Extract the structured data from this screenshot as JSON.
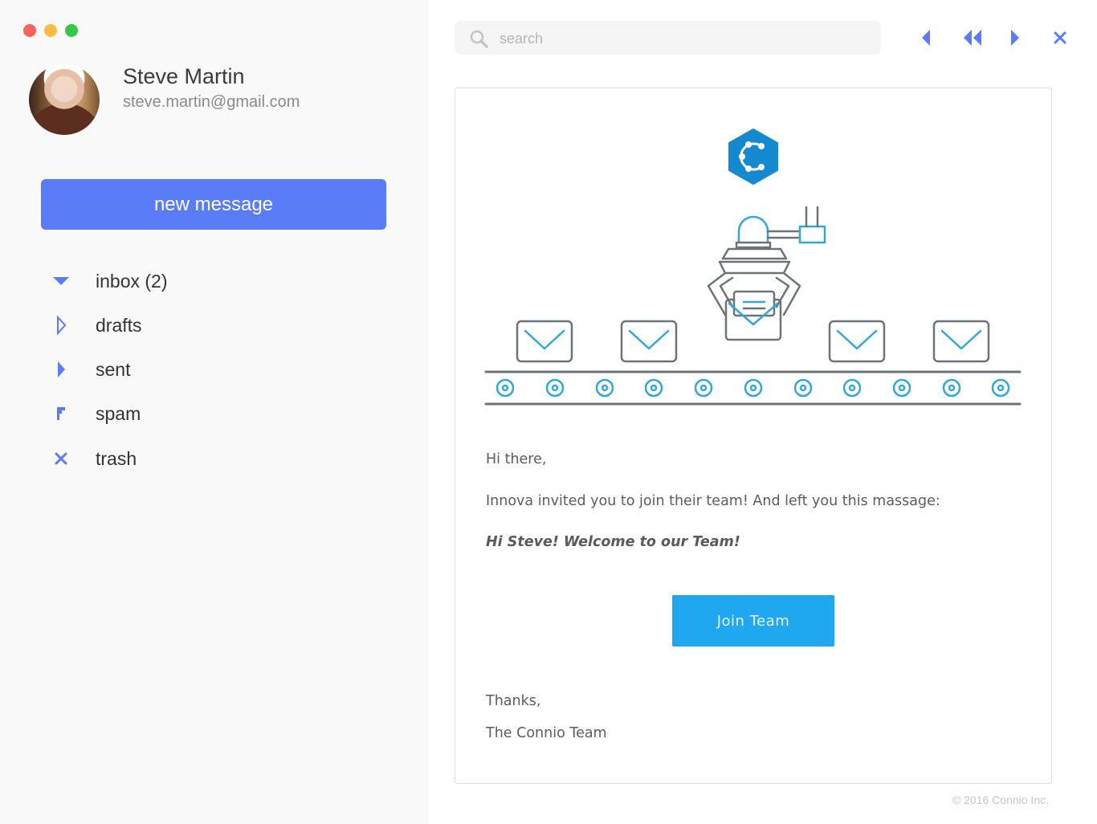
{
  "user": {
    "name": "Steve Martin",
    "email": "steve.martin@gmail.com"
  },
  "compose": {
    "label": "new message"
  },
  "nav": {
    "items": [
      {
        "label": "inbox (2)",
        "icon": "triangle-down-icon"
      },
      {
        "label": "drafts",
        "icon": "triangle-right-outline-icon"
      },
      {
        "label": "sent",
        "icon": "triangle-right-icon"
      },
      {
        "label": "spam",
        "icon": "flag-icon"
      },
      {
        "label": "trash",
        "icon": "close-icon"
      }
    ]
  },
  "search": {
    "placeholder": "search",
    "value": ""
  },
  "toolbar": {
    "icons": [
      "reply-icon",
      "reply-all-icon",
      "forward-icon",
      "close-icon"
    ]
  },
  "message": {
    "greeting": "Hi there,",
    "line1": "Innova invited you to join their team!  And left you this massage:",
    "quote": "Hi Steve! Welcome to our Team!",
    "button": "Join Team",
    "signoff": "Thanks,",
    "signature": "The Connio Team"
  },
  "footer": {
    "copyright": "©  2016 Connio Inc."
  },
  "colors": {
    "accent": "#5a7cf8",
    "join_button": "#1fa8ef",
    "logo": "#1489d0",
    "illustration_line": "#6e7378",
    "illustration_accent": "#34a6d9"
  }
}
